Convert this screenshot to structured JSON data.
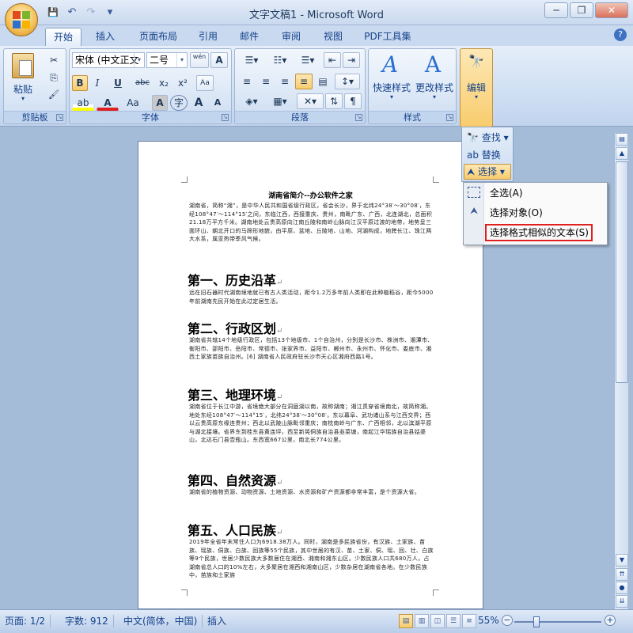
{
  "window": {
    "title": "文字文稿1 - Microsoft Word",
    "minimize": "─",
    "restore": "❐",
    "close": "✕"
  },
  "qat": {
    "save_icon": "💾",
    "undo_icon": "↶",
    "redo_icon": "↷",
    "more_icon": "▾"
  },
  "tabs": [
    {
      "label": "开始",
      "active": true
    },
    {
      "label": "插入"
    },
    {
      "label": "页面布局"
    },
    {
      "label": "引用"
    },
    {
      "label": "邮件"
    },
    {
      "label": "审阅"
    },
    {
      "label": "视图"
    },
    {
      "label": "PDF工具集"
    }
  ],
  "help": "?",
  "clipboard": {
    "label": "剪贴板",
    "paste": "粘贴",
    "cut_icon": "✂",
    "copy_icon": "⎘",
    "painter_icon": "🖌"
  },
  "font": {
    "label": "字体",
    "family": "宋体 (中文正文",
    "size": "二号",
    "wen": "wén",
    "a_box": "A",
    "bold": "B",
    "italic": "I",
    "underline": "U",
    "strike": "abc",
    "sub": "x₂",
    "sup": "x²",
    "clear": "Aa",
    "highlight": "ab",
    "color": "A",
    "case": "Aa",
    "shade": "A",
    "enclose": "字",
    "grow": "A",
    "shrink": "A"
  },
  "paragraph": {
    "label": "段落"
  },
  "styles": {
    "label": "样式",
    "quick": "快速样式",
    "change": "更改样式"
  },
  "editing": {
    "label": "编辑",
    "icon": "🔭"
  },
  "edit_panel": {
    "find": "查找",
    "replace": "替换",
    "select": "选择"
  },
  "select_menu": {
    "items": [
      "全选(A)",
      "选择对象(O)",
      "选择格式相似的文本(S)"
    ]
  },
  "document": {
    "title": "湖南省简介--办公软件之家",
    "intro": "湖南省，简称“湘”，是中华人民共和国省级行政区，省会长沙，界于北纬24°38′～30°08′，东经108°47′～114°15′之间，东临江西，西接重庆、贵州，南毗广东、广西，北连湖北，总面积21.18万平方千米。湖南地处云贵高原向江南丘陵和南岭山脉向江汉平原过渡的地带，地势呈三面环山、朝北开口的马蹄形地貌，由平原、盆地、丘陵地、山地、河湖构成，地跨长江、珠江两大水系，属亚热带季风气候。",
    "h1": "第一、历史沿革",
    "p1": "远在旧石器时代湖南境地就已有古人类活动，距今1.2万多年前人类即在此种植稻谷，距今5000年前湖南先民开始在此过定居生活。",
    "h2": "第二、行政区划",
    "p2": "湖南省共辖14个地级行政区，包括13个地级市、1个自治州，分别是长沙市、株洲市、湘潭市、衡阳市、邵阳市、岳阳市、常德市、张家界市、益阳市、郴州市、永州市、怀化市、娄底市、湘西土家族苗族自治州。[6] 湖南省人民政府驻长沙市天心区湘府西路1号。",
    "h3": "第三、地理环境",
    "p3": "湖南省位于长江中游，省境绝大部分在洞庭湖以南，故称湖南；湘江贯穿省境南北，故简称湘。地处东经108°47′～114°15′，北纬24°38′～30°08′，东以幕阜、武功诸山系与江西交界；西以云贵高原东缘连贵州；西北以武陵山脉毗邻重庆；南枕南岭与广东、广西相邻，北以滨湖平原与湖北接壤。省界东到桂东县黄连坪，西至新晃侗族自治县韭菜塘，南起江华瑶族自治县姑婆山，北达石门县壶瓶山。东西宽667公里，南北长774公里。",
    "h4": "第四、自然资源",
    "p4": "湖南省的植物资源、动物资源、土地资源、水资源和矿产资源都非常丰富，是个资源大省。",
    "h5": "第五、人口民族",
    "p5": "2019年全省年末常住人口为6918.38万人。同时，湖南是多民族省份，有汉族、土家族、苗族、瑶族、侗族、白族、回族等55个民族，其中世居的有汉、苗、土家、侗、瑶、回、壮、白族等9个民族，世居少数民族大多数居住在湘西、湘南和湘东山区。少数民族人口共680万人，占湖南省总人口的10%左右，大多聚居在湘西和湘南山区，少数杂居在湖南省各地。在少数民族中，苗族和土家族"
  },
  "status": {
    "page": "页面: 1/2",
    "words": "字数: 912",
    "lang": "中文(简体，中国)",
    "insert": "插入",
    "zoom": "55%",
    "zoom_level": 0.55
  }
}
